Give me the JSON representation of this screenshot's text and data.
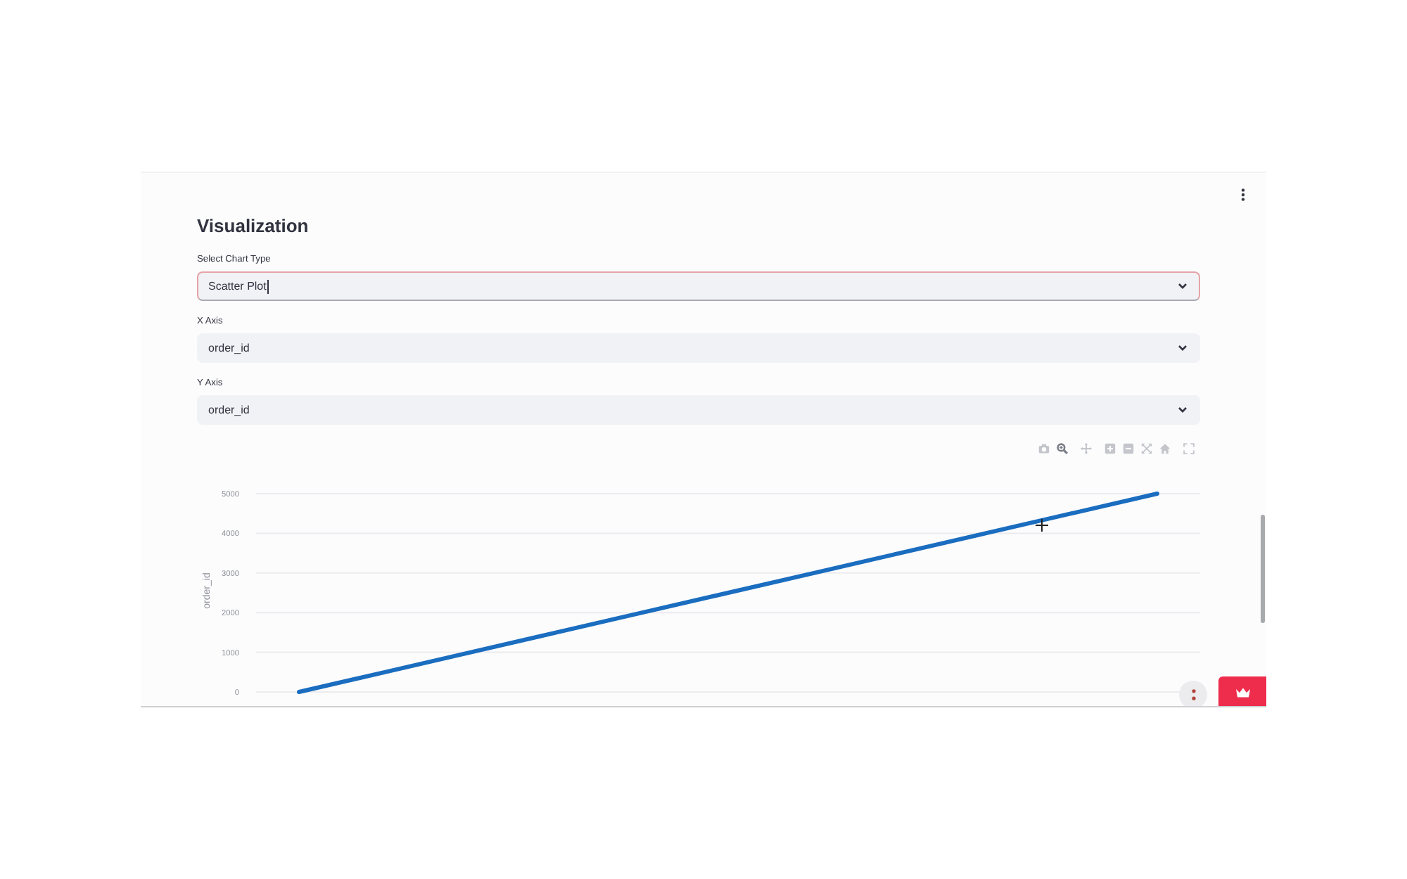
{
  "page": {
    "title": "Visualization"
  },
  "fields": [
    {
      "label": "Select Chart Type",
      "value": "Scatter Plot",
      "focused": true
    },
    {
      "label": "X Axis",
      "value": "order_id",
      "focused": false
    },
    {
      "label": "Y Axis",
      "value": "order_id",
      "focused": false
    }
  ],
  "chart": {
    "modebar_buttons": [
      {
        "selected": false
      },
      {
        "selected": true
      },
      {
        "selected": false
      },
      {
        "selected": false
      },
      {
        "selected": false
      },
      {
        "selected": false
      },
      {
        "selected": false
      },
      {
        "selected": false
      }
    ],
    "chart_data": {
      "type": "line",
      "ylabel": "order_id",
      "categories": [
        null,
        null,
        null,
        null,
        null,
        null,
        null,
        null,
        null,
        null,
        null
      ],
      "ylim": [
        0,
        5000
      ],
      "yticks": [
        0,
        1000,
        2000,
        3000,
        4000,
        5000
      ],
      "grid": true,
      "series": [
        {
          "color": "#1a6dbf",
          "values": [
            0,
            500,
            1000,
            1500,
            2000,
            2500,
            3000,
            3500,
            4000,
            4500,
            5000
          ]
        }
      ]
    }
  }
}
